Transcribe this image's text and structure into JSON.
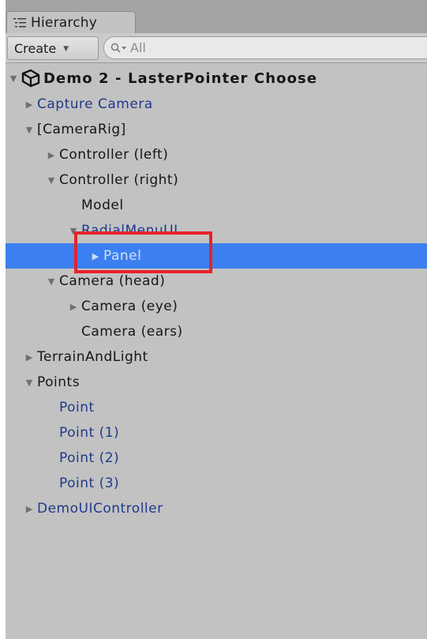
{
  "window": {
    "tab_label": "Hierarchy",
    "tab_icon": "hierarchy-list-icon"
  },
  "toolbar": {
    "create_label": "Create",
    "create_caret": "▼",
    "search_placeholder": "All",
    "search_icon": "search-filter-icon"
  },
  "colors": {
    "panel_bg": "#c2c2c2",
    "selection": "#3b7ff0",
    "prefab_text": "#1e3a8a",
    "annotation": "#e8222a"
  },
  "hierarchy": {
    "scene": {
      "label": "Demo 2 - LasterPointer Choose",
      "expanded": true,
      "icon": "unity-scene-icon"
    },
    "rows": [
      {
        "label": "Capture Camera",
        "depth": 1,
        "arrow": "collapsed",
        "prefab": true
      },
      {
        "label": "[CameraRig]",
        "depth": 1,
        "arrow": "expanded",
        "prefab": false
      },
      {
        "label": "Controller (left)",
        "depth": 2,
        "arrow": "collapsed",
        "prefab": false
      },
      {
        "label": "Controller (right)",
        "depth": 2,
        "arrow": "expanded",
        "prefab": false
      },
      {
        "label": "Model",
        "depth": 3,
        "arrow": "none",
        "prefab": false
      },
      {
        "label": "RadialMenuUI",
        "depth": 3,
        "arrow": "expanded",
        "prefab": true
      },
      {
        "label": "Panel",
        "depth": 4,
        "arrow": "collapsed",
        "prefab": true,
        "selected": true
      },
      {
        "label": "Camera (head)",
        "depth": 2,
        "arrow": "expanded",
        "prefab": false
      },
      {
        "label": "Camera (eye)",
        "depth": 3,
        "arrow": "collapsed",
        "prefab": false
      },
      {
        "label": "Camera (ears)",
        "depth": 3,
        "arrow": "none",
        "prefab": false
      },
      {
        "label": "TerrainAndLight",
        "depth": 1,
        "arrow": "collapsed",
        "prefab": false
      },
      {
        "label": "Points",
        "depth": 1,
        "arrow": "expanded",
        "prefab": false
      },
      {
        "label": "Point",
        "depth": 2,
        "arrow": "none",
        "prefab": true
      },
      {
        "label": "Point (1)",
        "depth": 2,
        "arrow": "none",
        "prefab": true
      },
      {
        "label": "Point (2)",
        "depth": 2,
        "arrow": "none",
        "prefab": true
      },
      {
        "label": "Point (3)",
        "depth": 2,
        "arrow": "none",
        "prefab": true
      },
      {
        "label": "DemoUIController",
        "depth": 1,
        "arrow": "collapsed",
        "prefab": true
      }
    ]
  }
}
